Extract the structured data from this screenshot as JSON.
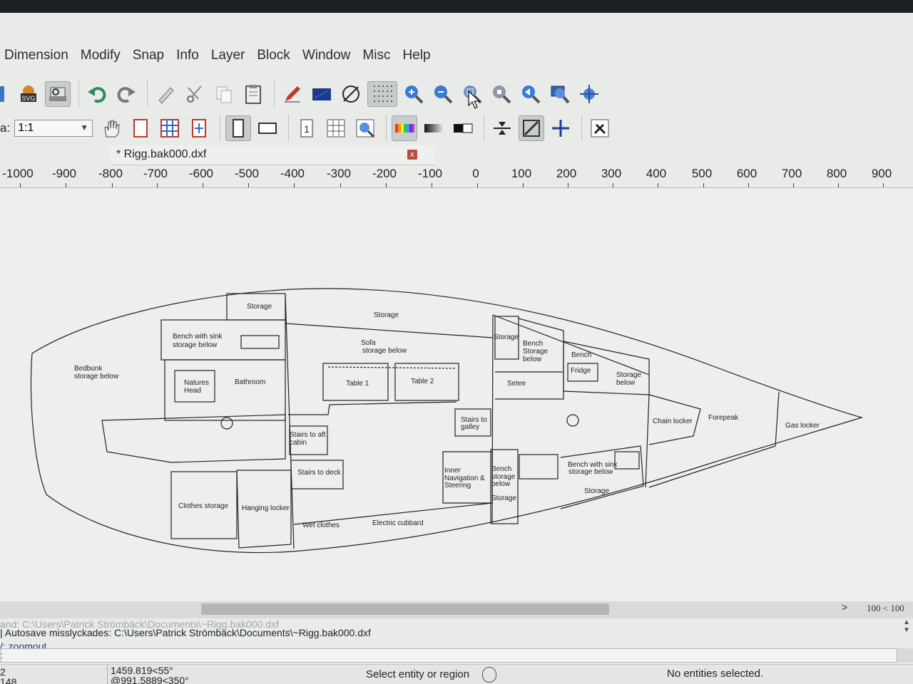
{
  "menu": [
    "Dimension",
    "Modify",
    "Snap",
    "Info",
    "Layer",
    "Block",
    "Window",
    "Misc",
    "Help"
  ],
  "toolbar1": {
    "buttons": [
      "export-svg-icon",
      "print-preview-icon",
      "undo-icon",
      "redo-icon",
      "eraser-icon",
      "cut-icon",
      "copy-icon",
      "paste-icon",
      "pen-icon",
      "background-color-icon",
      "diameter-icon",
      "grid-dots-icon",
      "zoom-in-icon",
      "zoom-out-icon",
      "zoom-auto-icon",
      "zoom-previous-icon",
      "zoom-back-icon",
      "zoom-window-icon",
      "zoom-pan-icon"
    ]
  },
  "toolbar2": {
    "zoom_label": "a:",
    "zoom_value": "1:1"
  },
  "tab": {
    "title": "* Rigg.bak000.dxf",
    "close": "x"
  },
  "ruler": {
    "labels": [
      "-1000",
      "-900",
      "-800",
      "-700",
      "-600",
      "-500",
      "-400",
      "-300",
      "-200",
      "-100",
      "0",
      "100",
      "200",
      "300",
      "400",
      "500",
      "600",
      "700",
      "800",
      "900"
    ]
  },
  "plan_labels": {
    "storage_top_left": "Storage",
    "storage_top_mid": "Storage",
    "bench_sink_1": "Bench with sink",
    "bench_sink_2": "storage below",
    "bedbunk_1": "Bedbunk",
    "bedbunk_2": "storage below",
    "natures_head_1": "Natures",
    "natures_head_2": "Head",
    "bathroom": "Bathroom",
    "sofa_1": "Sofa",
    "sofa_2": "storage below",
    "table1": "Table 1",
    "table2": "Table 2",
    "storage_right": "Storage",
    "bench_storage_1": "Bench",
    "bench_storage_2": "Storage",
    "bench_storage_3": "below",
    "setee": "Setee",
    "bench": "Bench",
    "fridge": "Fridge",
    "storage_below_1": "Storage",
    "storage_below_2": "below",
    "stairs_galley_1": "Stairs to",
    "stairs_galley_2": "galley",
    "chain_locker": "Chain locker",
    "forepeak": "Forepeak",
    "gas_locker": "Gas locker",
    "stairs_aft_1": "Stairs to aft",
    "stairs_aft_2": "cabin",
    "stairs_deck": "Stairs to deck",
    "inner_nav_1": "Inner",
    "inner_nav_2": "Navigation &",
    "inner_nav_3": "Steering",
    "bench_storage_b_1": "Bench",
    "bench_storage_b_2": "storage",
    "bench_storage_b_3": "below",
    "storage_lower": "Storage",
    "bench_sink_b_1": "Bench with sink",
    "bench_sink_b_2": "storage below",
    "storage_fwd_lower": "Storage",
    "clothes_storage": "Clothes storage",
    "hanging_locker": "Hanging locker",
    "wet_clothes": "Wet clothes",
    "electric_cupboard": "Electric cubbard"
  },
  "scrollbar": {
    "arrow": ">",
    "grid_readout": "100 < 100"
  },
  "history": {
    "faded": "and: C:\\Users\\Patrick Strömbäck\\Documents\\~Rigg.bak000.dxf",
    "autosave": "| Autosave misslyckades: C:\\Users\\Patrick Strömbäck\\Documents\\~Rigg.bak000.dxf",
    "zoomout": "/: zoomout"
  },
  "command_prompt": ":",
  "status": {
    "coord_a": "2",
    "coord_b": "148",
    "rel_a": "1459.819<55°",
    "rel_b": "@991.5889<350°",
    "action": "Select entity or region",
    "selection": "No entities selected."
  }
}
